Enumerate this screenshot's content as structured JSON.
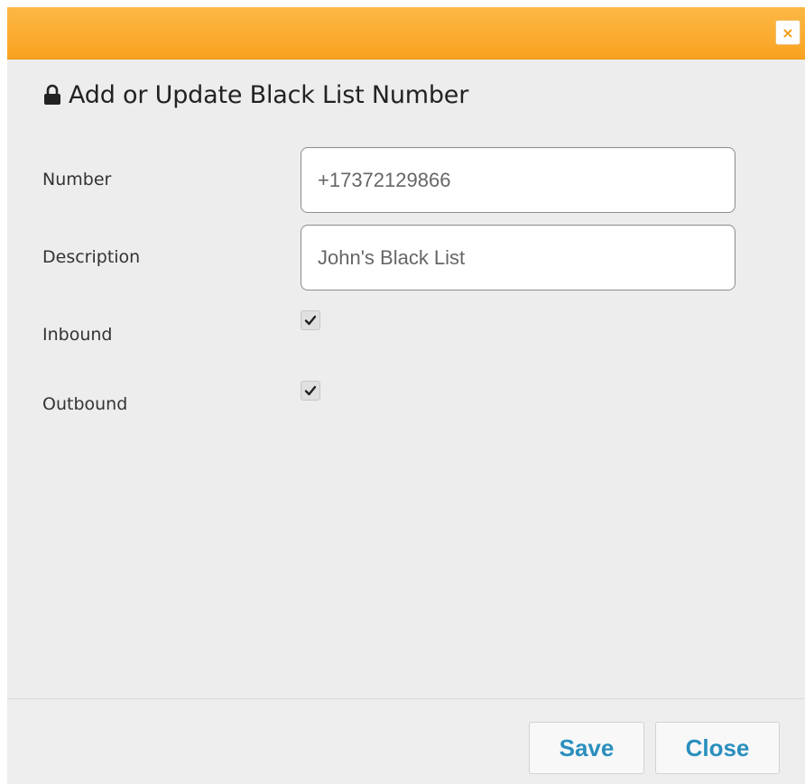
{
  "dialog": {
    "title": "Add or Update Black List Number",
    "close_icon": "×",
    "accent_color": "#fbad33",
    "button_text_color": "#2a8fbd"
  },
  "form": {
    "number_label": "Number",
    "number_value": "+17372129866",
    "description_label": "Description",
    "description_value": "John's Black List",
    "inbound_label": "Inbound",
    "inbound_checked": true,
    "outbound_label": "Outbound",
    "outbound_checked": true
  },
  "footer": {
    "save_label": "Save",
    "close_label": "Close"
  },
  "icons": {
    "title_icon": "lock-icon",
    "check_icon": "checkmark-icon"
  }
}
